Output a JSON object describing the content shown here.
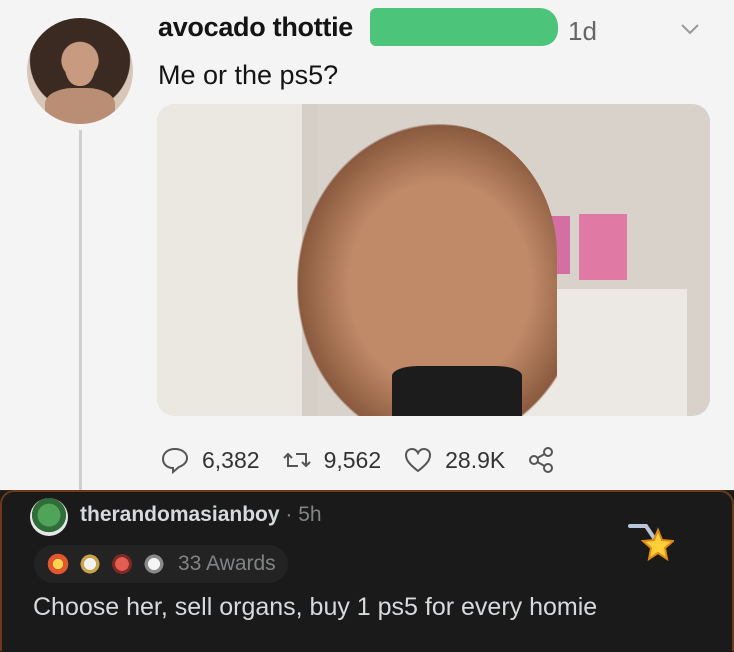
{
  "tweet": {
    "author_name": "avocado thottie",
    "time": "1d",
    "text": "Me or the ps5?",
    "stats": {
      "replies": "6,382",
      "retweets": "9,562",
      "likes": "28.9K"
    }
  },
  "comment": {
    "username": "therandomasianboy",
    "separator": "·",
    "time": "5h",
    "awards_label": "33 Awards",
    "text": "Choose her, sell organs, buy 1 ps5 for every homie"
  },
  "colors": {
    "redaction": "#4cc47a",
    "comment_bg": "#1a1a1b",
    "comment_border": "#6b3a19"
  },
  "icons": [
    "reply-icon",
    "retweet-icon",
    "like-icon",
    "share-icon",
    "chevron-down-icon",
    "award-icon"
  ]
}
